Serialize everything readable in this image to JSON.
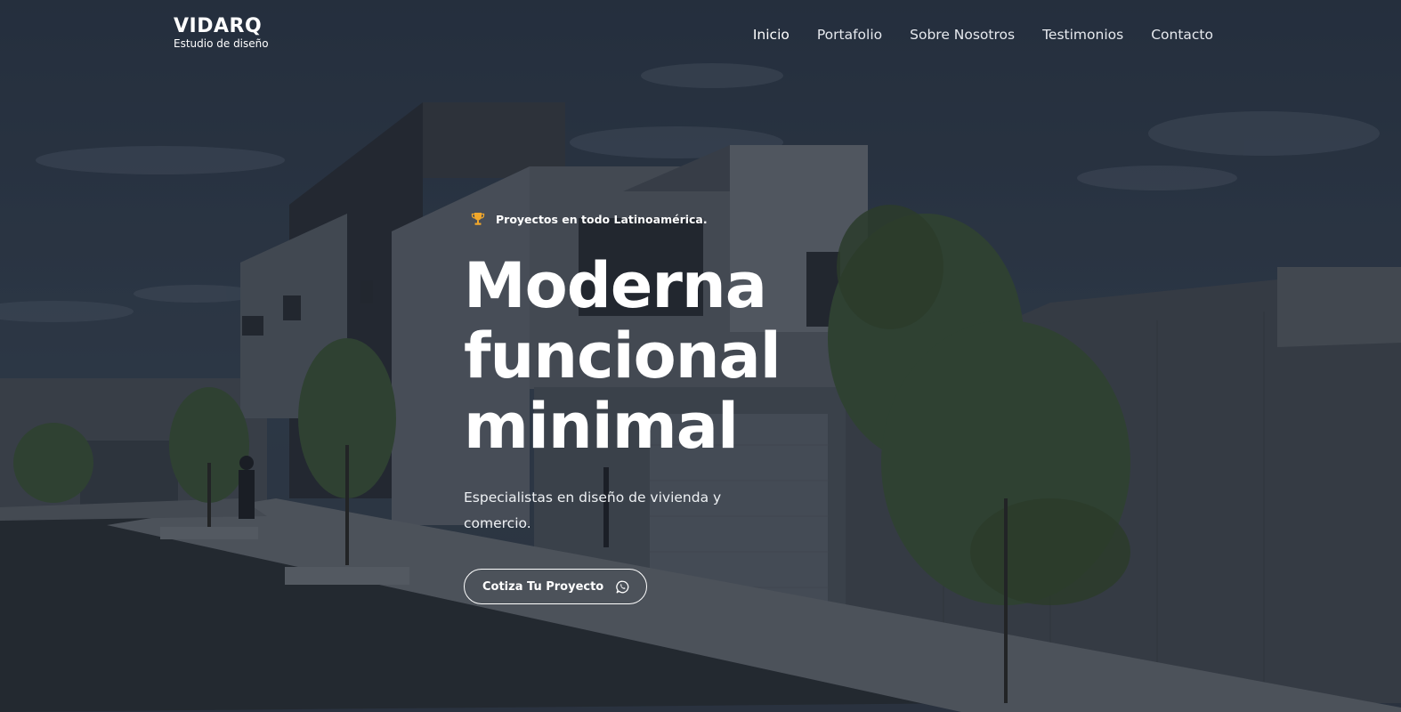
{
  "brand": {
    "title": "VIDARQ",
    "subtitle": "Estudio de diseño"
  },
  "nav": {
    "items": [
      {
        "label": "Inicio",
        "active": true
      },
      {
        "label": "Portafolio",
        "active": false
      },
      {
        "label": "Sobre Nosotros",
        "active": false
      },
      {
        "label": "Testimonios",
        "active": false
      },
      {
        "label": "Contacto",
        "active": false
      }
    ]
  },
  "hero": {
    "badge": {
      "icon": "trophy-icon",
      "text": "Proyectos en todo Latinoamérica."
    },
    "headline": [
      "Moderna",
      "funcional",
      "minimal"
    ],
    "subtitle": "Especialistas en diseño de vivienda y comercio.",
    "cta": {
      "label": "Cotiza Tu Proyecto",
      "icon": "whatsapp-icon"
    }
  },
  "colors": {
    "text": "#ffffff",
    "trophy": "#f0a72b",
    "overlay": "#141a24"
  }
}
